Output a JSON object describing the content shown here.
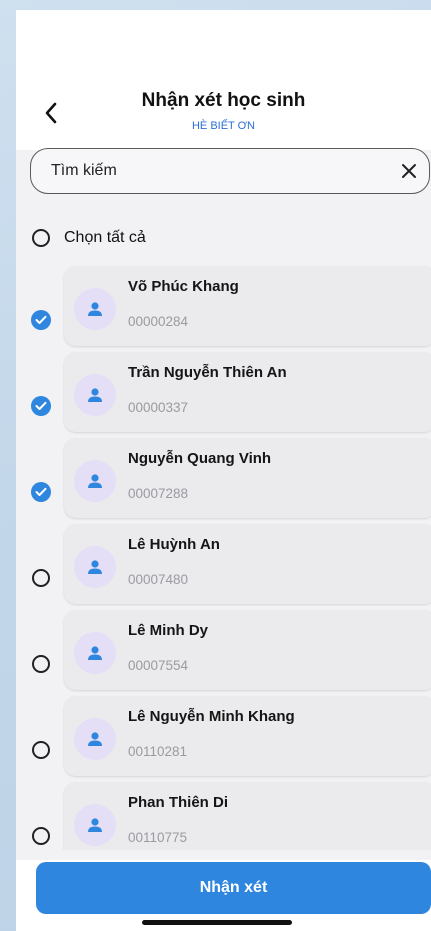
{
  "header": {
    "title": "Nhận xét học sinh",
    "subtitle": "HÈ BIẾT ƠN",
    "back_icon": "chevron-left-icon"
  },
  "search": {
    "value": "",
    "placeholder": "Tìm kiếm",
    "clear_icon": "close-icon"
  },
  "select_all": {
    "label": "Chọn tất cả",
    "checked": false
  },
  "students": [
    {
      "name": "Võ Phúc Khang",
      "code": "00000284",
      "checked": true
    },
    {
      "name": "Trần Nguyễn Thiên An",
      "code": "00000337",
      "checked": true
    },
    {
      "name": "Nguyễn Quang Vinh",
      "code": "00007288",
      "checked": true
    },
    {
      "name": "Lê Huỳnh An",
      "code": "00007480",
      "checked": false
    },
    {
      "name": "Lê Minh Dy",
      "code": "00007554",
      "checked": false
    },
    {
      "name": "Lê Nguyễn Minh Khang",
      "code": "00110281",
      "checked": false
    },
    {
      "name": "Phan Thiên Di",
      "code": "00110775",
      "checked": false
    }
  ],
  "action": {
    "label": "Nhận xét"
  },
  "colors": {
    "accent": "#2e86de",
    "avatar_bg": "#e4def6",
    "card_bg": "#ebebee"
  }
}
